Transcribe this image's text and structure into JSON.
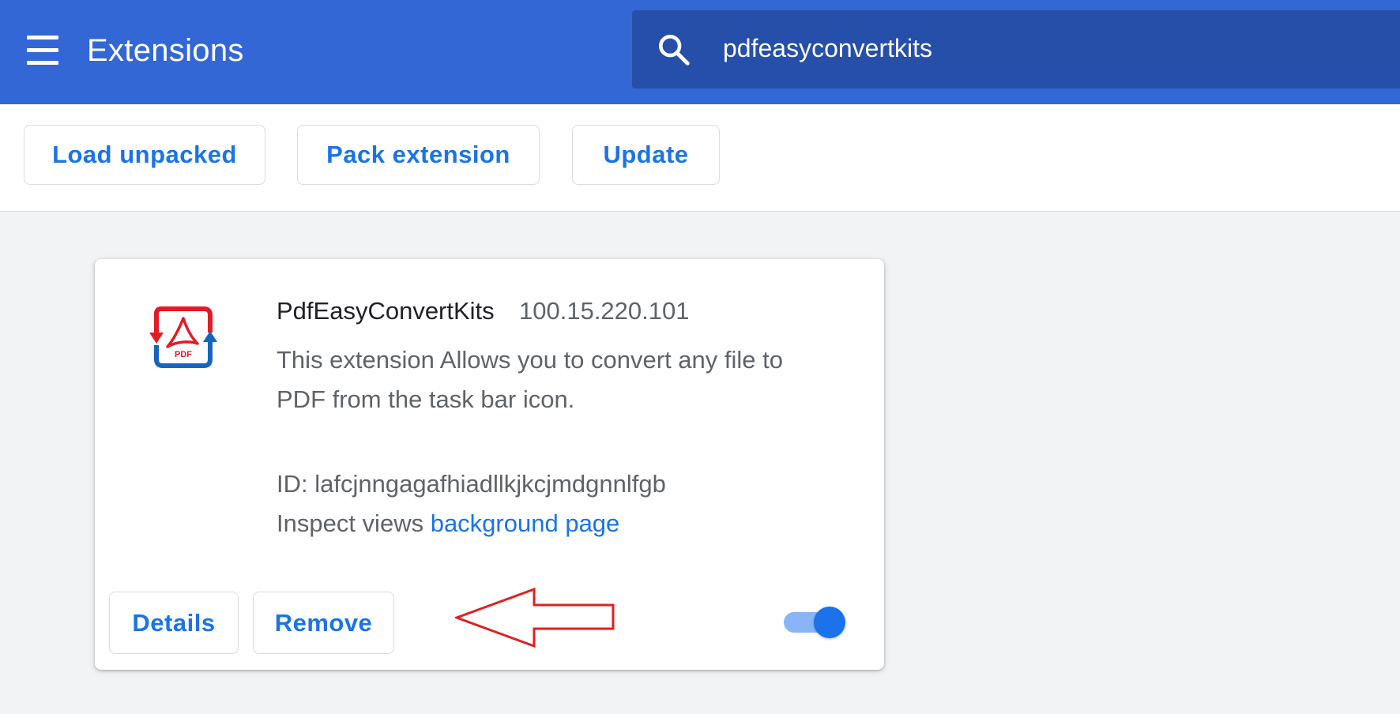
{
  "header": {
    "title": "Extensions",
    "search_value": "pdfeasyconvertkits",
    "brand_color": "#3367d6",
    "search_bg_color": "#254fa8"
  },
  "toolbar": {
    "buttons": [
      {
        "label": "Load unpacked"
      },
      {
        "label": "Pack extension"
      },
      {
        "label": "Update"
      }
    ]
  },
  "extension": {
    "icon": "pdf-convert-icon",
    "name": "PdfEasyConvertKits",
    "version": "100.15.220.101",
    "description": "This extension Allows you to convert any file to PDF from the task bar icon.",
    "id_text": "ID: lafcjnngagafhiadllkjkcjmdgnnlfgb",
    "inspect_label": "Inspect views",
    "inspect_link": "background page",
    "details_label": "Details",
    "remove_label": "Remove",
    "enabled": true,
    "accent_color": "#1a73e8"
  },
  "annotation": {
    "type": "arrow-left-outline",
    "color": "#e0201e"
  }
}
